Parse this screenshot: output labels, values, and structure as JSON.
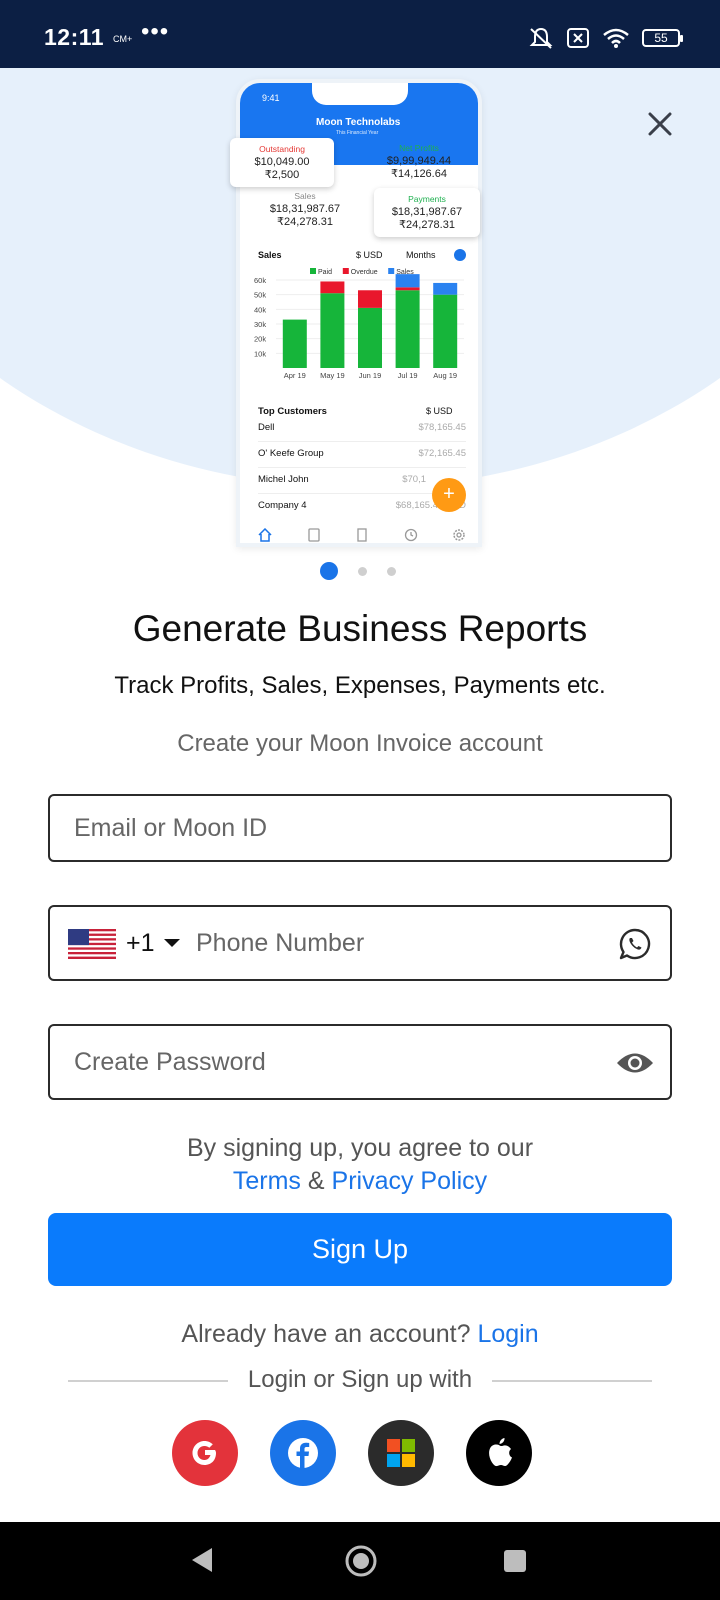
{
  "status_bar": {
    "time": "12:11",
    "carrier": "CM+",
    "dots": "•••",
    "battery": "55"
  },
  "phone_preview": {
    "time": "9:41",
    "company": "Moon Technolabs",
    "period": "This Financial Year",
    "outstanding": {
      "label": "Outstanding",
      "usd": "$10,049.00",
      "inr": "₹2,500"
    },
    "net_profits": {
      "label": "Net Profits",
      "usd": "$9,99,949.44",
      "inr": "₹14,126.64"
    },
    "sales_card": {
      "label": "Sales",
      "usd": "$18,31,987.67",
      "inr": "₹24,278.31"
    },
    "payments": {
      "label": "Payments",
      "usd": "$18,31,987.67",
      "inr": "₹24,278.31"
    },
    "sales_title": "Sales",
    "currency": "$ USD",
    "period_filter": "Months",
    "top_customers_title": "Top Customers",
    "top_customers_currency": "$ USD",
    "customers": [
      {
        "name": "Dell",
        "amount": "$78,165.45"
      },
      {
        "name": "O' Keefe Group",
        "amount": "$72,165.45"
      },
      {
        "name": "Michel John",
        "amount": "$70,1"
      },
      {
        "name": "Company 4",
        "amount": "$68,165.45 USD"
      }
    ],
    "fab": "+"
  },
  "chart_data": {
    "type": "bar",
    "categories": [
      "Apr 19",
      "May 19",
      "Jun 19",
      "Jul 19",
      "Aug 19"
    ],
    "series": [
      {
        "name": "Paid",
        "values": [
          33,
          51,
          41,
          53,
          50
        ]
      },
      {
        "name": "Overdue",
        "values": [
          0,
          8,
          12,
          2,
          0
        ]
      },
      {
        "name": "Sales",
        "values": [
          0,
          0,
          0,
          9,
          8
        ]
      }
    ],
    "ylim": [
      0,
      60
    ],
    "yticks": [
      "60k",
      "50k",
      "40k",
      "30k",
      "20k",
      "10k"
    ],
    "colors": {
      "Paid": "#16b53a",
      "Overdue": "#e9172c",
      "Sales": "#2a82f0"
    }
  },
  "carousel": {
    "pages": 3,
    "active": 0
  },
  "content": {
    "title": "Generate Business Reports",
    "subtitle": "Track Profits, Sales, Expenses, Payments etc.",
    "create_account": "Create your Moon Invoice account"
  },
  "form": {
    "email_placeholder": "Email or Moon ID",
    "country_code": "+1",
    "phone_placeholder": "Phone Number",
    "password_placeholder": "Create Password"
  },
  "agreement": {
    "text": "By signing up, you agree to our",
    "terms": "Terms",
    "amp": "&",
    "privacy": "Privacy Policy"
  },
  "signup_button": "Sign Up",
  "login_prompt": {
    "text": "Already have an account?",
    "link": "Login"
  },
  "social": {
    "divider_text": "Login or Sign up with",
    "colors": {
      "google": "#e3333b",
      "facebook": "#1a74e8",
      "microsoft": "#2b2b2b",
      "apple": "#000000"
    }
  }
}
